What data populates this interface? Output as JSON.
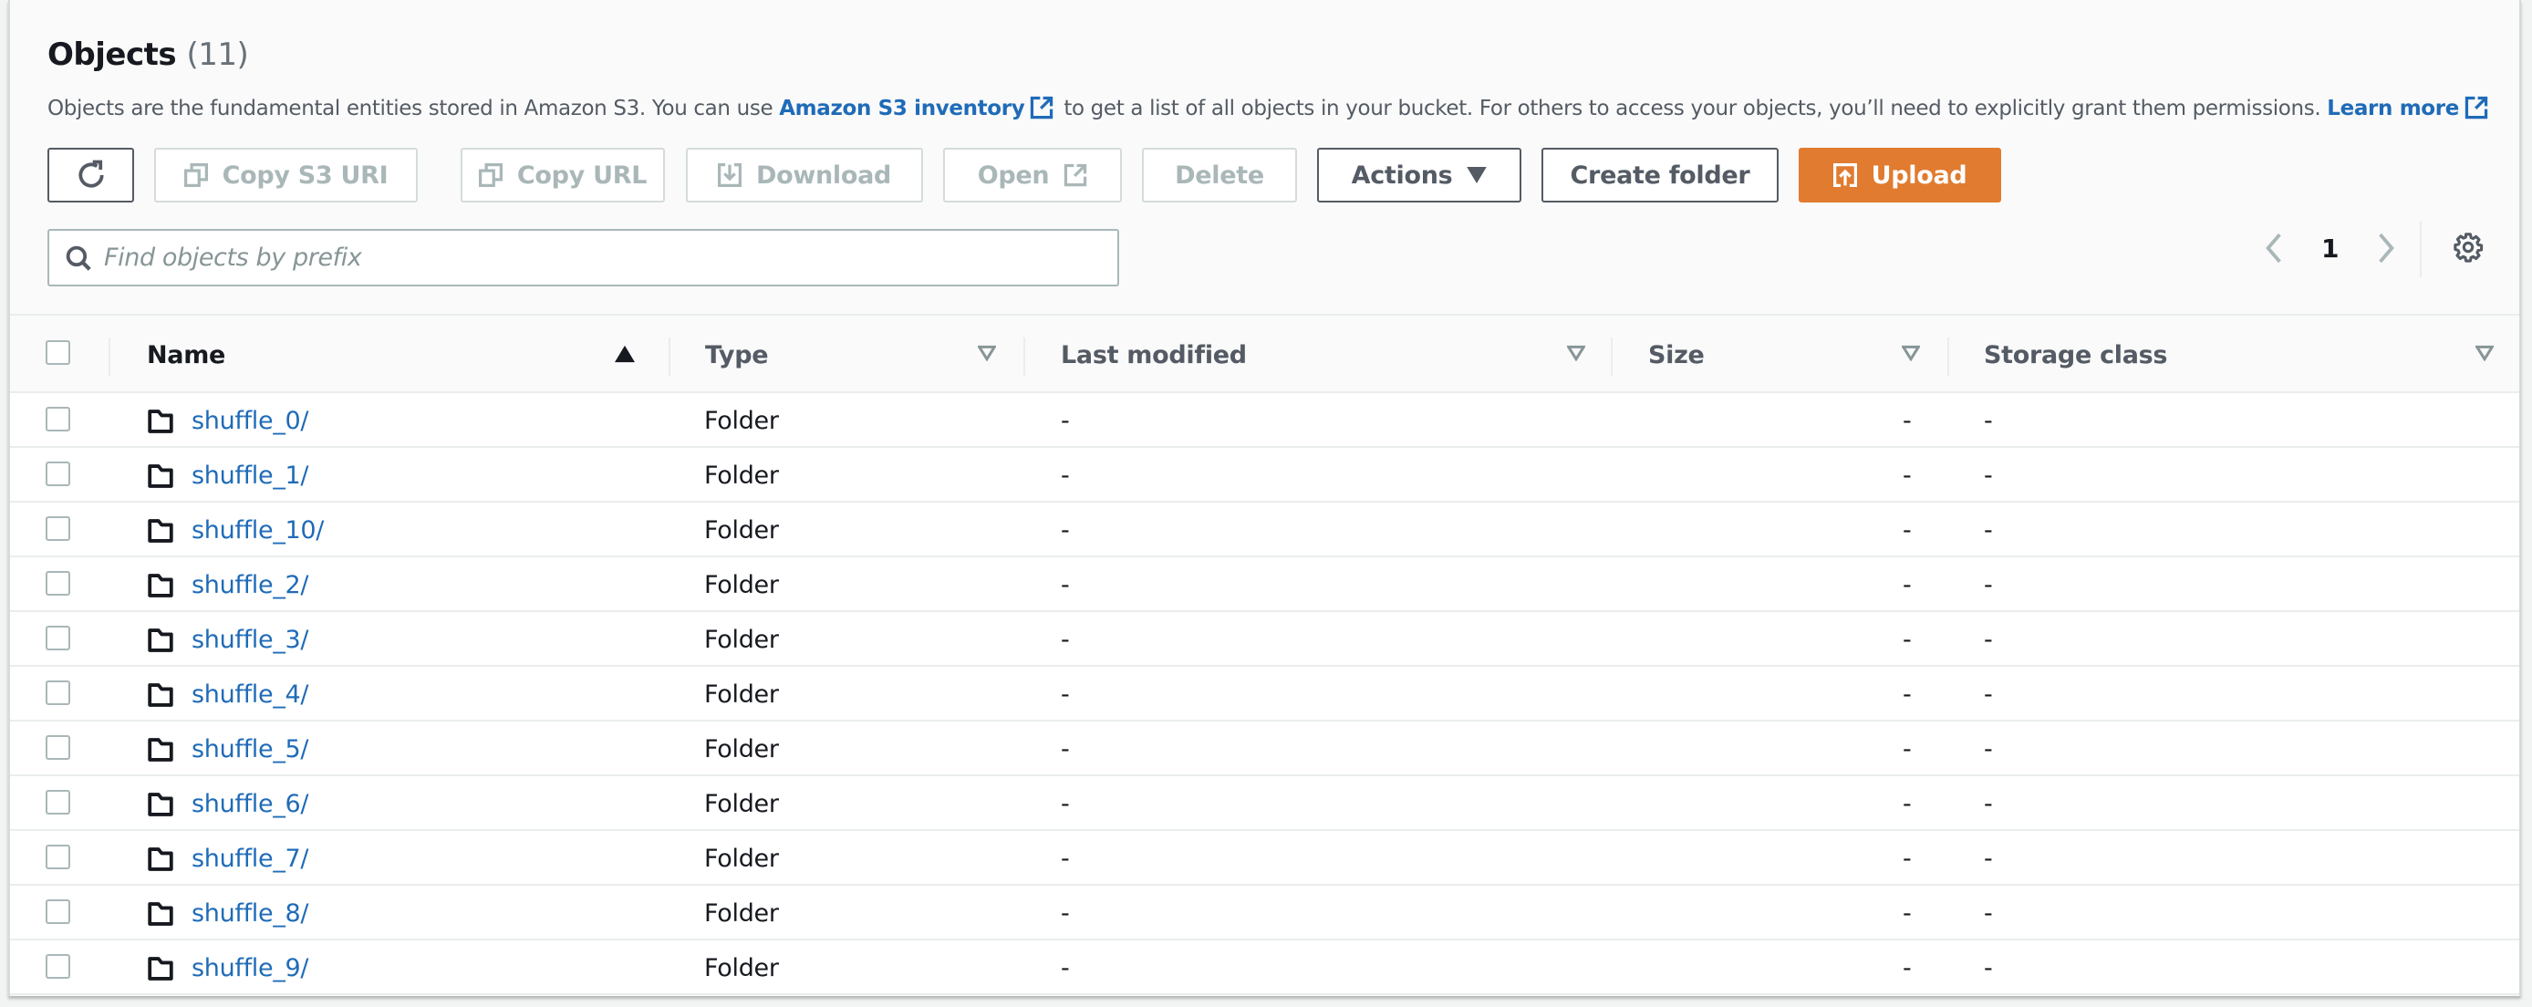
{
  "header": {
    "title": "Objects",
    "count": "(11)",
    "description_parts": {
      "before_link": "Objects are the fundamental entities stored in Amazon S3. You can use ",
      "inventory_link": "Amazon S3 inventory",
      "middle": " to get a list of all objects in your bucket. For others to access your objects, you’ll need to explicitly grant them permissions. ",
      "learn_more_link": "Learn more"
    }
  },
  "toolbar": {
    "refresh_icon": "refresh-icon",
    "copy_s3_uri": "Copy S3 URI",
    "copy_url": "Copy URL",
    "download": "Download",
    "open": "Open",
    "delete": "Delete",
    "actions": "Actions",
    "create_folder": "Create folder",
    "upload": "Upload"
  },
  "search": {
    "placeholder": "Find objects by prefix",
    "value": ""
  },
  "pagination": {
    "current_page": "1"
  },
  "colors": {
    "link": "#1f6bb8",
    "primary": "#e07b30",
    "disabled": "#aab7b8",
    "text": "#16191f"
  },
  "table": {
    "columns": [
      "Name",
      "Type",
      "Last modified",
      "Size",
      "Storage class"
    ],
    "sorted_column": "Name",
    "sort_direction": "ascending",
    "rows": [
      {
        "name": "shuffle_0/",
        "type": "Folder",
        "last_modified": "-",
        "size": "-",
        "storage_class": "-"
      },
      {
        "name": "shuffle_1/",
        "type": "Folder",
        "last_modified": "-",
        "size": "-",
        "storage_class": "-"
      },
      {
        "name": "shuffle_10/",
        "type": "Folder",
        "last_modified": "-",
        "size": "-",
        "storage_class": "-"
      },
      {
        "name": "shuffle_2/",
        "type": "Folder",
        "last_modified": "-",
        "size": "-",
        "storage_class": "-"
      },
      {
        "name": "shuffle_3/",
        "type": "Folder",
        "last_modified": "-",
        "size": "-",
        "storage_class": "-"
      },
      {
        "name": "shuffle_4/",
        "type": "Folder",
        "last_modified": "-",
        "size": "-",
        "storage_class": "-"
      },
      {
        "name": "shuffle_5/",
        "type": "Folder",
        "last_modified": "-",
        "size": "-",
        "storage_class": "-"
      },
      {
        "name": "shuffle_6/",
        "type": "Folder",
        "last_modified": "-",
        "size": "-",
        "storage_class": "-"
      },
      {
        "name": "shuffle_7/",
        "type": "Folder",
        "last_modified": "-",
        "size": "-",
        "storage_class": "-"
      },
      {
        "name": "shuffle_8/",
        "type": "Folder",
        "last_modified": "-",
        "size": "-",
        "storage_class": "-"
      },
      {
        "name": "shuffle_9/",
        "type": "Folder",
        "last_modified": "-",
        "size": "-",
        "storage_class": "-"
      }
    ]
  }
}
